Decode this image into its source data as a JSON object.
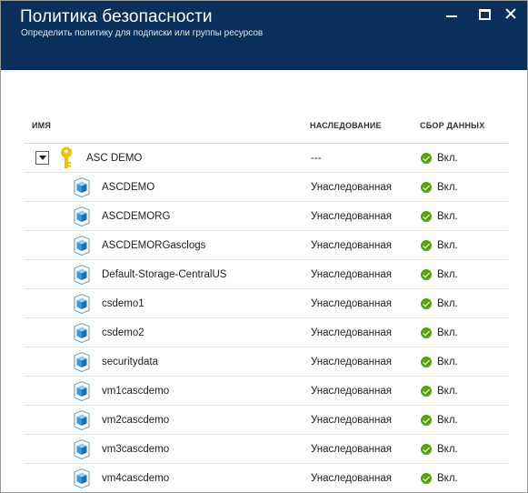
{
  "header": {
    "title": "Политика безопасности",
    "subtitle": "Определить политику для подписки или группы ресурсов",
    "background": "#0a2f5c"
  },
  "table": {
    "columns": {
      "name": "ИМЯ",
      "inheritance": "НАСЛЕДОВАНИЕ",
      "collection": "СБОР ДАННЫХ"
    },
    "parent": {
      "name": "ASC DEMO",
      "inheritance": "---",
      "collection": "Вкл.",
      "icon": "key-icon",
      "expanded": true
    },
    "rows": [
      {
        "name": "ASCDEMO",
        "inheritance": "Унаследованная",
        "collection": "Вкл."
      },
      {
        "name": "ASCDEMORG",
        "inheritance": "Унаследованная",
        "collection": "Вкл."
      },
      {
        "name": "ASCDEMORGasclogs",
        "inheritance": "Унаследованная",
        "collection": "Вкл."
      },
      {
        "name": "Default-Storage-CentralUS",
        "inheritance": "Унаследованная",
        "collection": "Вкл."
      },
      {
        "name": "csdemo1",
        "inheritance": "Унаследованная",
        "collection": "Вкл."
      },
      {
        "name": "csdemo2",
        "inheritance": "Унаследованная",
        "collection": "Вкл."
      },
      {
        "name": "securitydata",
        "inheritance": "Унаследованная",
        "collection": "Вкл."
      },
      {
        "name": "vm1cascdemo",
        "inheritance": "Унаследованная",
        "collection": "Вкл."
      },
      {
        "name": "vm2cascdemo",
        "inheritance": "Унаследованная",
        "collection": "Вкл."
      },
      {
        "name": "vm3cascdemo",
        "inheritance": "Унаследованная",
        "collection": "Вкл."
      },
      {
        "name": "vm4cascdemo",
        "inheritance": "Унаследованная",
        "collection": "Вкл."
      }
    ],
    "status_color": "#5aa500"
  }
}
